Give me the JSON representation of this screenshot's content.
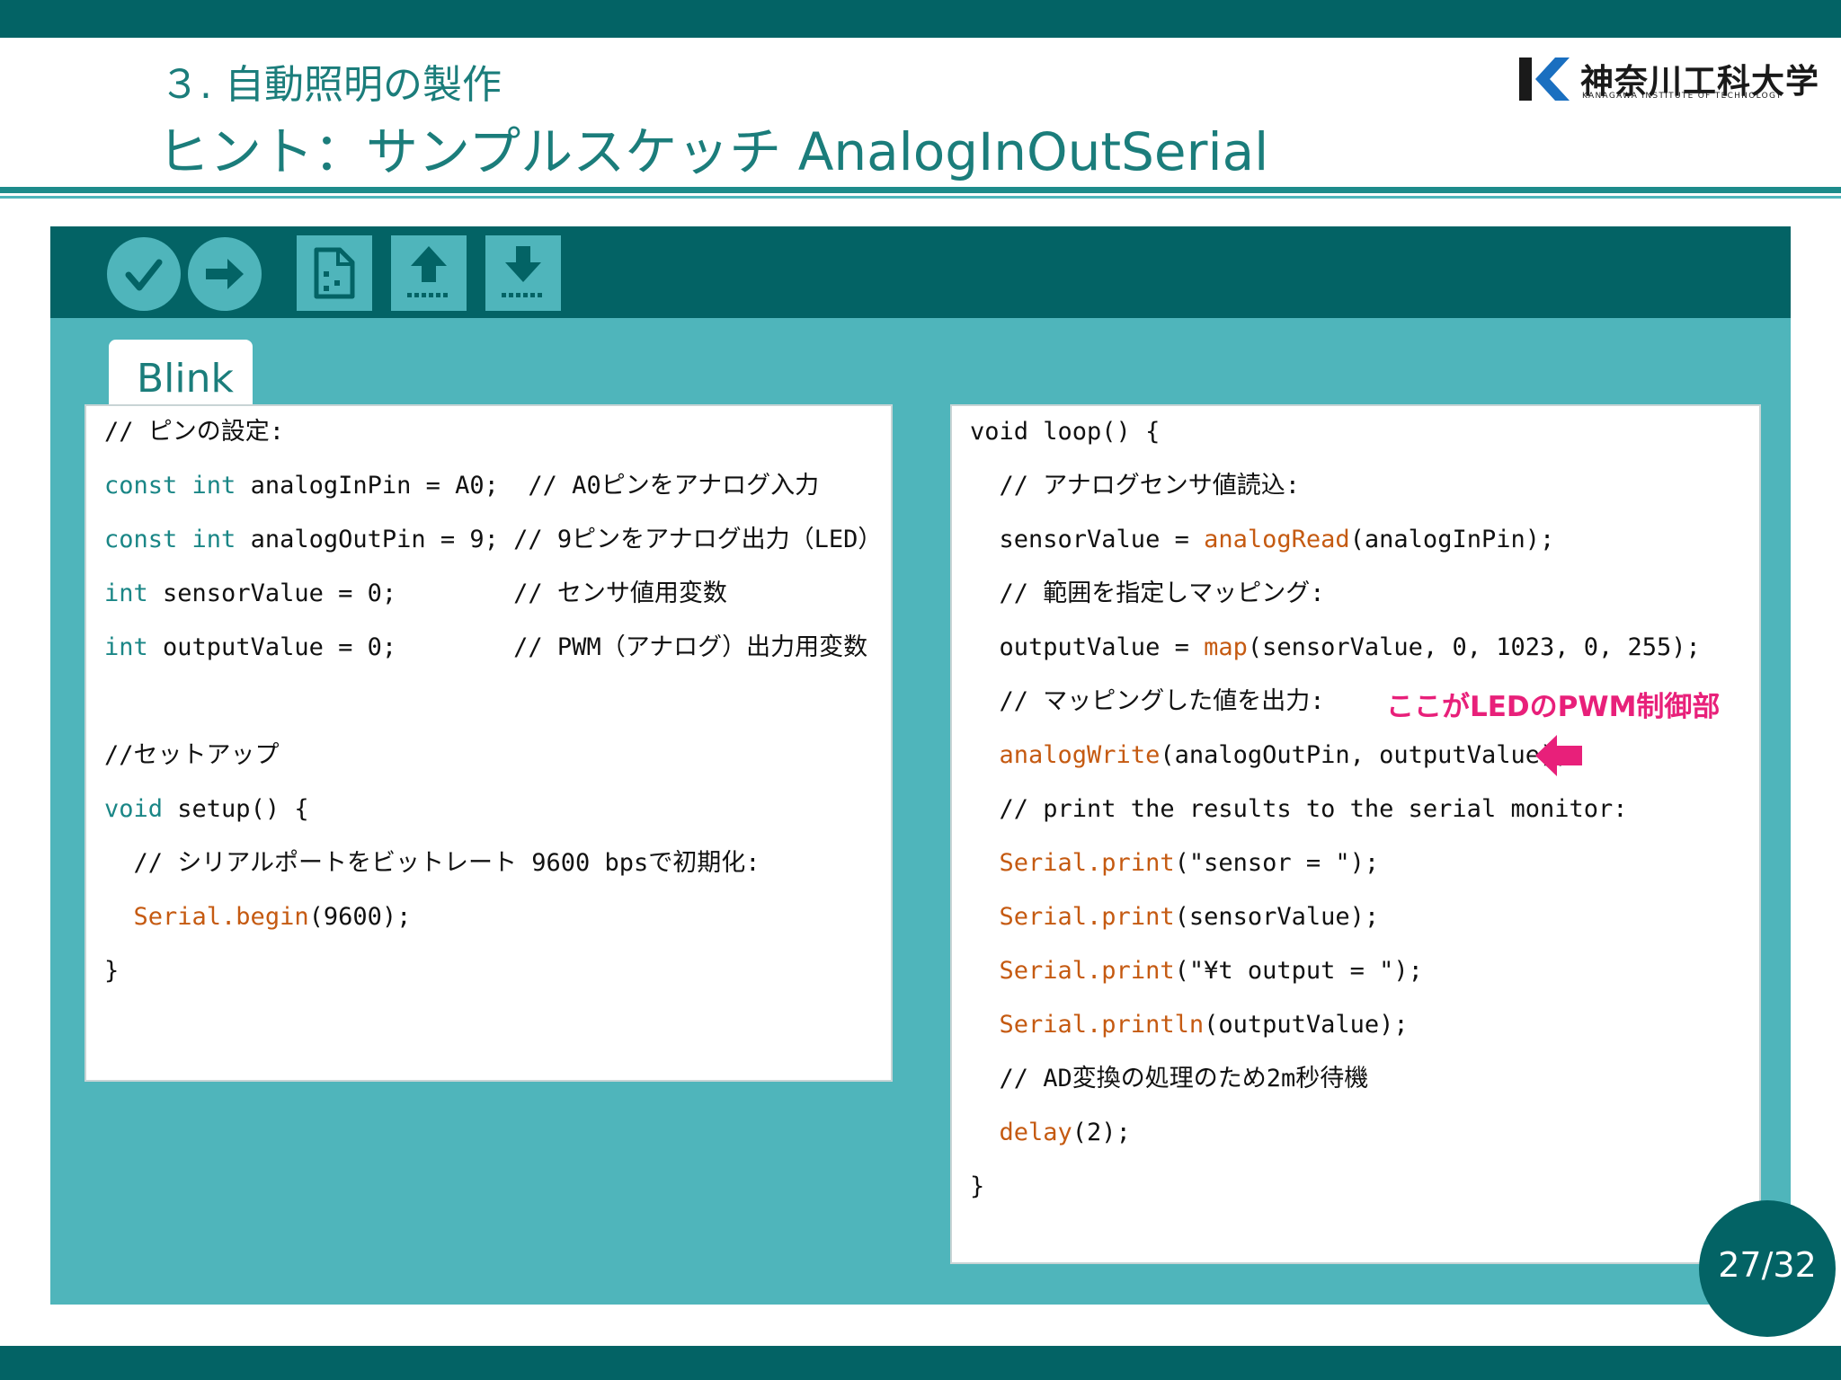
{
  "slide": {
    "subtitle": "３. 自動照明の製作",
    "title": "ヒント：サンプルスケッチ AnalogInOutSerial",
    "page": "27/32"
  },
  "logo": {
    "name": "神奈川工科大学",
    "english": "KANAGAWA INSTITUTE OF TECHNOLOGY"
  },
  "toolbar": {
    "buttons": [
      "verify-icon",
      "upload-arrow-icon",
      "new-sketch-icon",
      "open-sketch-icon",
      "save-sketch-icon"
    ]
  },
  "editor": {
    "tab_label": "Blink",
    "left_code": [
      {
        "parts": [
          {
            "t": "// ピンの設定:",
            "c": "txt"
          }
        ]
      },
      {
        "parts": [
          {
            "t": "const int",
            "c": "kw"
          },
          {
            "t": " analogInPin = A0;  // A0ピンをアナログ入力",
            "c": "txt"
          }
        ]
      },
      {
        "parts": [
          {
            "t": "const int",
            "c": "kw"
          },
          {
            "t": " analogOutPin = 9; // 9ピンをアナログ出力（LED）",
            "c": "txt"
          }
        ]
      },
      {
        "parts": [
          {
            "t": "int",
            "c": "kw"
          },
          {
            "t": " sensorValue = 0;        // センサ値用変数",
            "c": "txt"
          }
        ]
      },
      {
        "parts": [
          {
            "t": "int",
            "c": "kw"
          },
          {
            "t": " outputValue = 0;        // PWM（アナログ）出力用変数",
            "c": "txt"
          }
        ]
      },
      {
        "parts": []
      },
      {
        "parts": [
          {
            "t": "//セットアップ",
            "c": "txt"
          }
        ]
      },
      {
        "parts": [
          {
            "t": "void",
            "c": "kw"
          },
          {
            "t": " setup() {",
            "c": "txt"
          }
        ]
      },
      {
        "parts": [
          {
            "t": "  // シリアルポートをビットレート 9600 bpsで初期化:",
            "c": "txt"
          }
        ]
      },
      {
        "parts": [
          {
            "t": "  ",
            "c": "txt"
          },
          {
            "t": "Serial.begin",
            "c": "fn"
          },
          {
            "t": "(9600);",
            "c": "txt"
          }
        ]
      },
      {
        "parts": [
          {
            "t": "}",
            "c": "txt"
          }
        ]
      }
    ],
    "right_code": [
      {
        "parts": [
          {
            "t": "void loop() {",
            "c": "txt"
          }
        ]
      },
      {
        "parts": [
          {
            "t": "  // アナログセンサ値読込:",
            "c": "txt"
          }
        ]
      },
      {
        "parts": [
          {
            "t": "  sensorValue = ",
            "c": "txt"
          },
          {
            "t": "analogRead",
            "c": "fn"
          },
          {
            "t": "(analogInPin);",
            "c": "txt"
          }
        ]
      },
      {
        "parts": [
          {
            "t": "  // 範囲を指定しマッピング:",
            "c": "txt"
          }
        ]
      },
      {
        "parts": [
          {
            "t": "  outputValue = ",
            "c": "txt"
          },
          {
            "t": "map",
            "c": "fn"
          },
          {
            "t": "(sensorValue, 0, 1023, 0, 255);",
            "c": "txt"
          }
        ]
      },
      {
        "parts": [
          {
            "t": "  // マッピングした値を出力:",
            "c": "txt"
          }
        ]
      },
      {
        "parts": [
          {
            "t": "  ",
            "c": "txt"
          },
          {
            "t": "analogWrite",
            "c": "fn"
          },
          {
            "t": "(analogOutPin, outputValue);",
            "c": "txt"
          }
        ]
      },
      {
        "parts": [
          {
            "t": "  // print the results to the serial monitor:",
            "c": "txt"
          }
        ]
      },
      {
        "parts": [
          {
            "t": "  ",
            "c": "txt"
          },
          {
            "t": "Serial.print",
            "c": "fn"
          },
          {
            "t": "(\"sensor = \");",
            "c": "txt"
          }
        ]
      },
      {
        "parts": [
          {
            "t": "  ",
            "c": "txt"
          },
          {
            "t": "Serial.print",
            "c": "fn"
          },
          {
            "t": "(sensorValue);",
            "c": "txt"
          }
        ]
      },
      {
        "parts": [
          {
            "t": "  ",
            "c": "txt"
          },
          {
            "t": "Serial.print",
            "c": "fn"
          },
          {
            "t": "(\"¥t output = \");",
            "c": "txt"
          }
        ]
      },
      {
        "parts": [
          {
            "t": "  ",
            "c": "txt"
          },
          {
            "t": "Serial.println",
            "c": "fn"
          },
          {
            "t": "(outputValue);",
            "c": "txt"
          }
        ]
      },
      {
        "parts": [
          {
            "t": "  // AD変換の処理のため2m秒待機",
            "c": "txt"
          }
        ]
      },
      {
        "parts": [
          {
            "t": "  ",
            "c": "txt"
          },
          {
            "t": "delay",
            "c": "fn"
          },
          {
            "t": "(2);",
            "c": "txt"
          }
        ]
      },
      {
        "parts": [
          {
            "t": "}",
            "c": "txt"
          }
        ]
      }
    ]
  },
  "callout": {
    "text": "ここがLEDのPWM制御部",
    "color": "#e8207a"
  },
  "colors": {
    "dark_teal": "#036365",
    "light_teal": "#4fb5bb",
    "title_teal": "#1b7d7b",
    "keyword": "#1a8686",
    "function": "#c55a11"
  }
}
